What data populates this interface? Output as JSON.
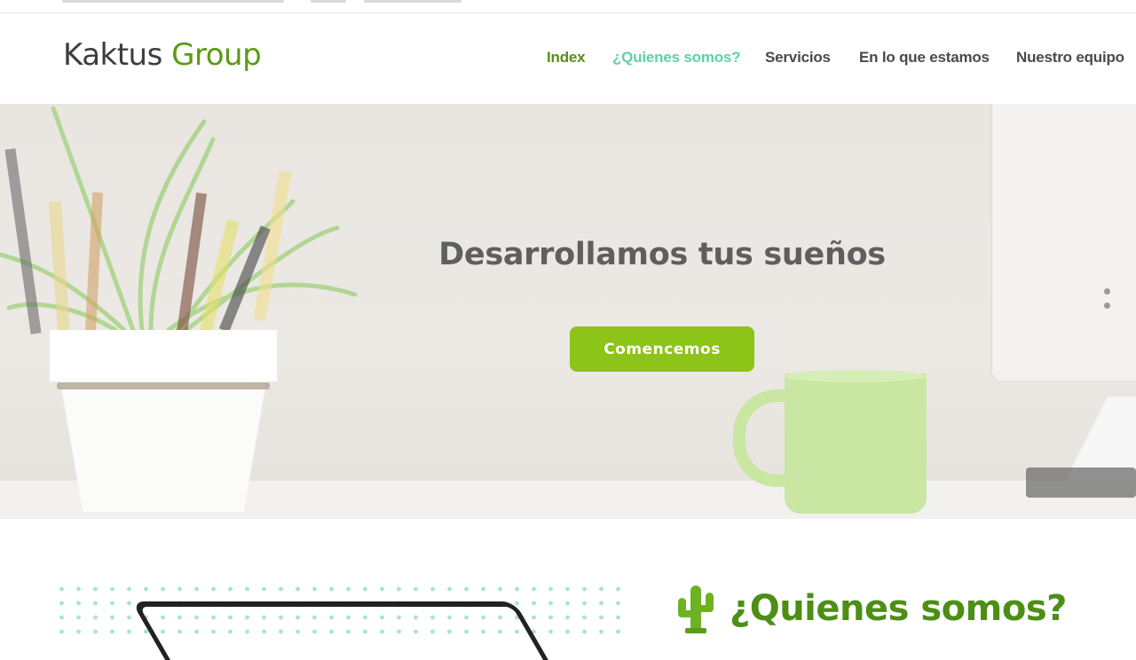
{
  "header": {
    "logo_word1": "Kaktus",
    "logo_word2": "Group",
    "nav": [
      {
        "label": "Index",
        "state": "active"
      },
      {
        "label": "¿Quienes somos?",
        "state": "hover"
      },
      {
        "label": "Servicios",
        "state": "normal"
      },
      {
        "label": "En lo que estamos",
        "state": "normal"
      },
      {
        "label": "Nuestro equipo",
        "state": "normal"
      }
    ]
  },
  "hero": {
    "title": "Desarrollamos tus sueños",
    "cta_label": "Comencemos"
  },
  "about": {
    "title": "¿Quienes somos?",
    "icon": "cactus-icon"
  },
  "colors": {
    "brand_green": "#8cc417",
    "logo_green": "#5b9a14",
    "nav_active": "#5b8c16",
    "nav_hover": "#5fd0a8",
    "text_dark": "#4a4a4a"
  }
}
